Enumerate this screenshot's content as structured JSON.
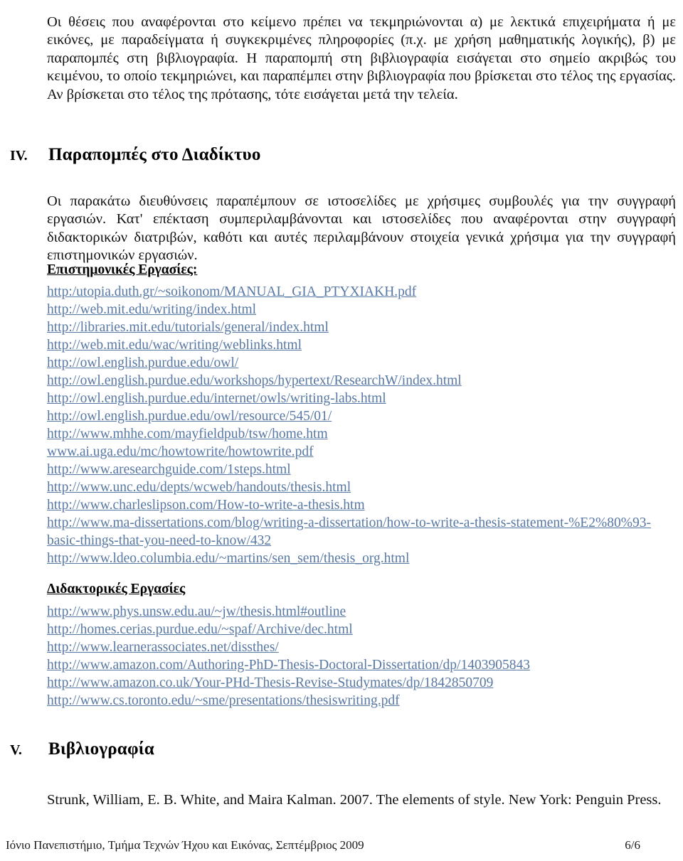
{
  "document": {
    "language": "el",
    "page_label": "6/6",
    "link_color": "#5878a4",
    "text_color": "#111111"
  },
  "intro_paragraph": {
    "text": "Οι θέσεις που αναφέρονται στο κείμενο πρέπει να τεκμηριώνονται α) με λεκτικά επιχειρήματα ή με εικόνες, με παραδείγματα ή συγκεκριμένες πληροφορίες (π.χ. με χρήση μαθηματικής λογικής), β) με παραπομπές στη βιβλιογραφία. Η παραπομπή στη βιβλιογραφία εισάγεται στο σημείο ακριβώς του κειμένου, το οποίο τεκμηριώνει, και παραπέμπει στην βιβλιογραφία που βρίσκεται στο τέλος της εργασίας. Αν βρίσκεται στο τέλος της πρότασης, τότε εισάγεται μετά την τελεία."
  },
  "section_iv": {
    "numeral": "IV.",
    "title": "Παραπομπές στο Διαδίκτυο",
    "paragraph": "Οι παρακάτω διευθύνσεις παραπέμπουν σε ιστοσελίδες με χρήσιμες συμβουλές για την συγγραφή εργασιών. Κατ' επέκταση συμπεριλαμβάνονται και ιστοσελίδες που αναφέρονται στην συγγραφή διδακτορικών διατριβών, καθότι και αυτές περιλαμβάνουν στοιχεία γενικά χρήσιμα για την συγγραφή επιστημονικών εργασιών.",
    "scientific_works": {
      "heading": "Επιστημονικές Εργασίες:",
      "links": [
        "http:/utopia.duth.gr/~soikonom/MANUAL_GIA_PTYXIAKH.pdf",
        "http://web.mit.edu/writing/index.html",
        "http://libraries.mit.edu/tutorials/general/index.html",
        "http://web.mit.edu/wac/writing/weblinks.html",
        "http://owl.english.purdue.edu/owl/",
        "http://owl.english.purdue.edu/workshops/hypertext/ResearchW/index.html",
        "http://owl.english.purdue.edu/internet/owls/writing-labs.html",
        "http://owl.english.purdue.edu/owl/resource/545/01/",
        "http://www.mhhe.com/mayfieldpub/tsw/home.htm",
        "www.ai.uga.edu/mc/howtowrite/howtowrite.pdf",
        "http://www.aresearchguide.com/1steps.html",
        "http://www.unc.edu/depts/wcweb/handouts/thesis.html",
        "http://www.charleslipson.com/How-to-write-a-thesis.htm",
        "http://www.ma-dissertations.com/blog/writing-a-dissertation/how-to-write-a-thesis-statement-%E2%80%93-basic-things-that-you-need-to-know/432",
        "http://www.ldeo.columbia.edu/~martins/sen_sem/thesis_org.html"
      ]
    },
    "doctoral_works": {
      "heading": "Διδακτορικές Εργασίες",
      "links": [
        "http://www.phys.unsw.edu.au/~jw/thesis.html#outline",
        "http://homes.cerias.purdue.edu/~spaf/Archive/dec.html",
        "http://www.learnerassociates.net/dissthes/",
        "http://www.amazon.com/Authoring-PhD-Thesis-Doctoral-Dissertation/dp/1403905843",
        "http://www.amazon.co.uk/Your-PHd-Thesis-Revise-Studymates/dp/1842850709",
        "http://www.cs.toronto.edu/~sme/presentations/thesiswriting.pdf"
      ]
    }
  },
  "section_v": {
    "numeral": "V.",
    "title": "Βιβλιογραφία",
    "entries": [
      "Strunk, William, E. B. White, and Maira Kalman. 2007. The elements of style. New York: Penguin Press."
    ]
  },
  "footer": {
    "left": "Ιόνιο Πανεπιστήμιο, Τμήμα Τεχνών Ήχου και Εικόνας, Σεπτέμβριος 2009",
    "right": "6/6"
  }
}
